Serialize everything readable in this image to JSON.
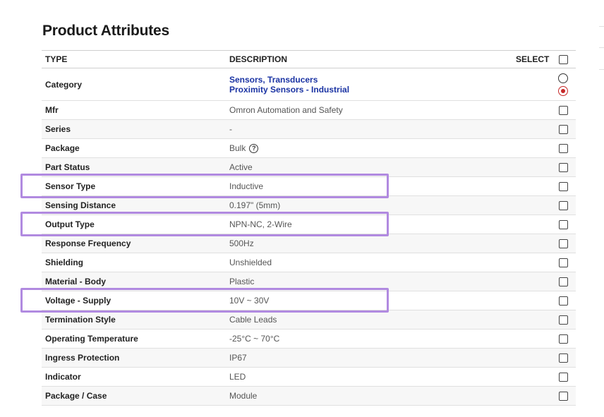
{
  "title": "Product Attributes",
  "header": {
    "type": "TYPE",
    "description": "DESCRIPTION",
    "select": "SELECT"
  },
  "category": {
    "label": "Category",
    "links": [
      "Sensors, Transducers",
      "Proximity Sensors - Industrial"
    ]
  },
  "rows": [
    {
      "type": "Mfr",
      "value": "Omron Automation and Safety"
    },
    {
      "type": "Series",
      "value": "-"
    },
    {
      "type": "Package",
      "value": "Bulk"
    },
    {
      "type": "Part Status",
      "value": "Active"
    },
    {
      "type": "Sensor Type",
      "value": "Inductive"
    },
    {
      "type": "Sensing Distance",
      "value": "0.197\" (5mm)"
    },
    {
      "type": "Output Type",
      "value": "NPN-NC, 2-Wire"
    },
    {
      "type": "Response Frequency",
      "value": "500Hz"
    },
    {
      "type": "Shielding",
      "value": "Unshielded"
    },
    {
      "type": "Material - Body",
      "value": "Plastic"
    },
    {
      "type": "Voltage - Supply",
      "value": "10V ~ 30V"
    },
    {
      "type": "Termination Style",
      "value": "Cable Leads"
    },
    {
      "type": "Operating Temperature",
      "value": "-25°C ~ 70°C"
    },
    {
      "type": "Ingress Protection",
      "value": "IP67"
    },
    {
      "type": "Indicator",
      "value": "LED"
    },
    {
      "type": "Package / Case",
      "value": "Module"
    }
  ],
  "highlight_color": "#b18ae0",
  "link_color": "#1a33a3",
  "radio_selected_color": "#c62828"
}
